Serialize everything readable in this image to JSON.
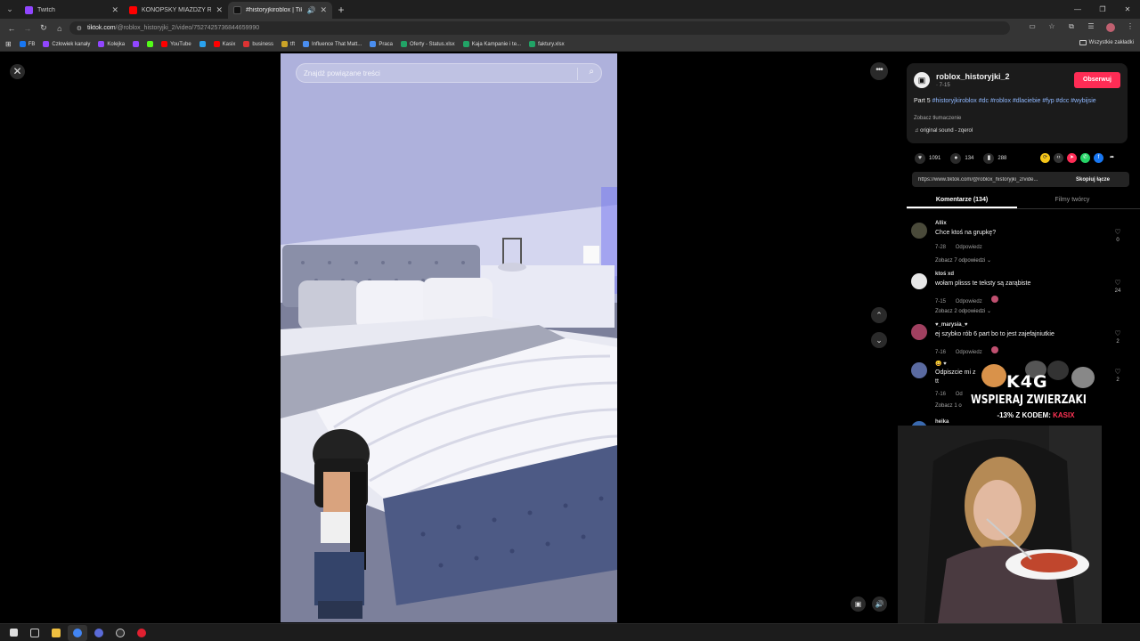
{
  "browser": {
    "tabs": [
      {
        "title": "Twitch",
        "color": "#9146ff"
      },
      {
        "title": "KONOPSKY MIAŻDŻY REVO ZA",
        "color": "#ff0000"
      },
      {
        "title": "#historyjkiroblox | TikTok",
        "color": "#000000"
      }
    ],
    "url_host": "tiktok.com",
    "url_path": "/@roblox_historyjki_2/video/7527425736844659990",
    "bookmarks": [
      {
        "label": "FB",
        "color": "#1877f2"
      },
      {
        "label": "Człowiek kanały",
        "color": "#9146ff"
      },
      {
        "label": "Kolejka",
        "color": "#9146ff"
      },
      {
        "label": "",
        "color": "#9146ff"
      },
      {
        "label": "",
        "color": "#53fc18"
      },
      {
        "label": "YouTube",
        "color": "#ff0000"
      },
      {
        "label": "",
        "color": "#2aa3ef"
      },
      {
        "label": "Kasix",
        "color": "#ff0000"
      },
      {
        "label": "business",
        "color": "#d33"
      },
      {
        "label": "tft",
        "color": "#c9a227"
      },
      {
        "label": "Influence That Matt...",
        "color": "#4a8ef0"
      },
      {
        "label": "Praca",
        "color": "#4a8ef0"
      },
      {
        "label": "Oferty - Status.xlsx",
        "color": "#21a366"
      },
      {
        "label": "Kaja Kampanie i te...",
        "color": "#21a366"
      },
      {
        "label": "faktury.xlsx",
        "color": "#21a366"
      }
    ],
    "bookmarks_all": "Wszystkie zakładki"
  },
  "video": {
    "search_placeholder": "Znajdź powiązane treści"
  },
  "post": {
    "author": "roblox_historyjki_2",
    "date": "· 7-15",
    "follow_label": "Obserwuj",
    "desc_prefix": "Part 5 ",
    "hashtags": "#historyjkiroblox #dc #roblox #dlaciebie #fyp #dcc #wybijsie",
    "translate": "Zobacz tłumaczenie",
    "sound": "original sound - zqerol",
    "likes": "1091",
    "comments_count": "134",
    "saves": "288",
    "link": "https://www.tiktok.com/@roblox_historyjki_2/vide...",
    "copy_label": "Skopiuj łącze",
    "tab_comments": "Komentarze (134)",
    "tab_creator": "Filmy twórcy"
  },
  "comments": [
    {
      "user": "Allix",
      "text": "Chce ktoś na grupkę?",
      "date": "7-28",
      "reply": "Odpowiedz",
      "more": "Zobacz 7 odpowiedzi ⌄",
      "likes": "0",
      "avatar": "#4a4a3a"
    },
    {
      "user": "ktoś xd",
      "text": "wołam plisss te teksty są zarąbiste",
      "date": "7-15",
      "reply": "Odpowiedz",
      "more": "Zobacz 2 odpowiedzi ⌄",
      "likes": "24",
      "avatar": "#e8e8e8"
    },
    {
      "user": "♥_marysia_♥",
      "text": "ej szybko rób 6 part bo to jest zajefajniutkie",
      "date": "7-16",
      "reply": "Odpowiedz",
      "more": "",
      "likes": "2",
      "avatar": "#a04060"
    },
    {
      "user": "😀 ♥",
      "text": "Odpiszcie mi z",
      "text2": "tt",
      "date": "7-16",
      "reply": "Od",
      "more": "Zobacz 1 o",
      "likes": "2",
      "avatar": "#5a6aa0"
    },
    {
      "user": "heika",
      "text": "",
      "date": "",
      "reply": "",
      "more": "",
      "likes": "",
      "avatar": "#3a6ab0"
    }
  ],
  "promo": {
    "logo": "K4G",
    "line1": "WSPIERAJ ZWIERZAKI",
    "line2_prefix": "-13% Z KODEM: ",
    "code": "KASIX"
  },
  "colors": {
    "accent": "#fe2c55",
    "hashtag": "#8fb8ff",
    "page_bg": "#000000"
  }
}
